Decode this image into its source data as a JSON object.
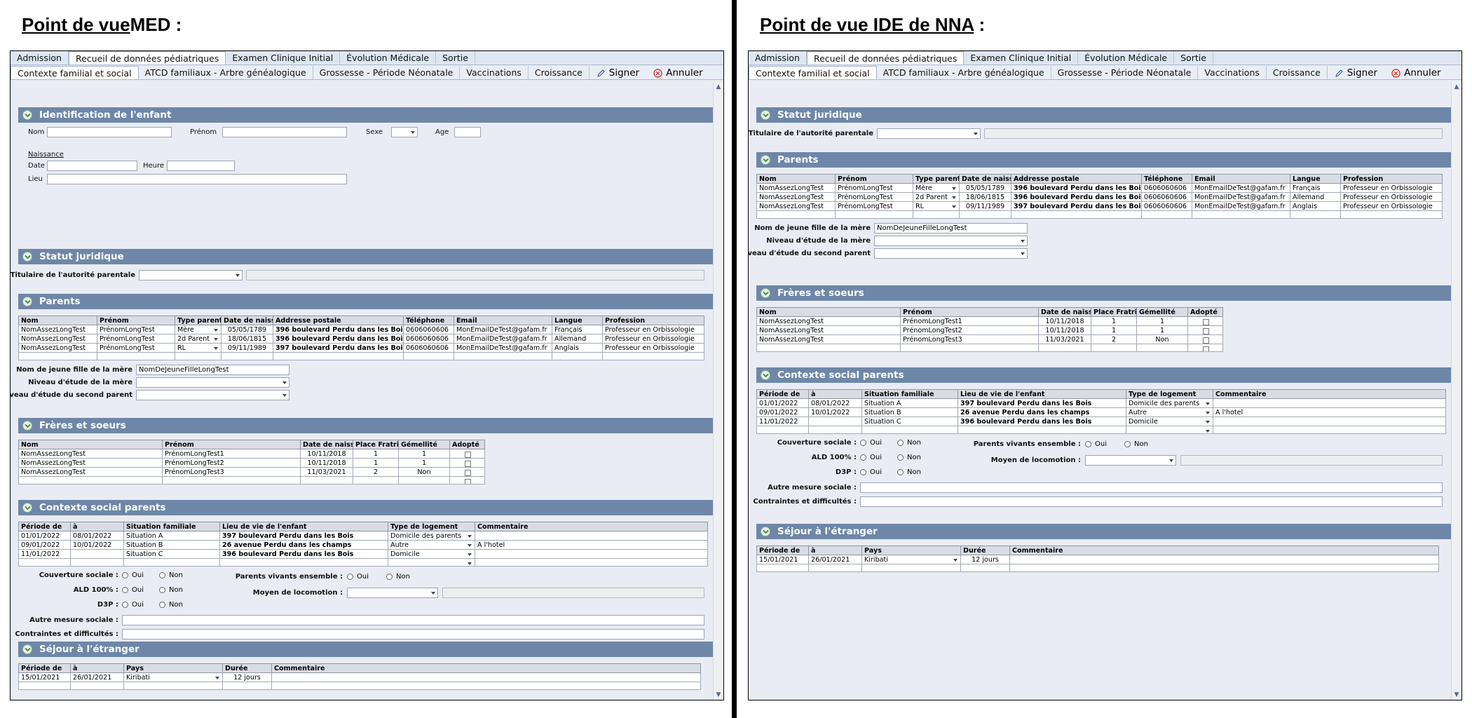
{
  "panels": {
    "med": {
      "title_underlined": "Point de vue",
      "title_rest": "MED",
      "title_colon": " :"
    },
    "nna": {
      "title_underlined": "Point de vue IDE de NNA",
      "title_rest": "",
      "title_colon": " :"
    }
  },
  "tabs_row1": [
    "Admission",
    "Recueil de données pédiatriques",
    "Examen Clinique Initial",
    "Évolution Médicale",
    "Sortie"
  ],
  "tabs_row2": [
    "Contexte familial et social",
    "ATCD familiaux - Arbre généalogique",
    "Grossesse - Période Néonatale",
    "Vaccinations",
    "Croissance"
  ],
  "actions": {
    "sign": "Signer",
    "cancel": "Annuler"
  },
  "sections": {
    "identification": "Identification de l'enfant",
    "statut": "Statut juridique",
    "parents": "Parents",
    "freres": "Frères et soeurs",
    "contexte": "Contexte social  parents",
    "sejour": "Séjour à l'étranger"
  },
  "identification": {
    "nom": "Nom",
    "prenom": "Prénom",
    "sexe": "Sexe",
    "age": "Age",
    "naissance": "Naissance",
    "date": "Date",
    "heure": "Heure",
    "lieu": "Lieu"
  },
  "statut": {
    "titulaire": "Titulaire de l'autorité parentale"
  },
  "parents": {
    "headers": [
      "Nom",
      "Prénom",
      "Type parent",
      "Date de naiss.",
      "Addresse postale",
      "Téléphone",
      "Email",
      "Langue",
      "Profession"
    ],
    "rows": [
      [
        "NomAssezLongTest",
        "PrénomLongTest",
        "Mère",
        "05/05/1789",
        "396 boulevard Perdu dans les Bois",
        "0606060606",
        "MonEmailDeTest@gafam.fr",
        "Français",
        "Professeur en Orbissologie"
      ],
      [
        "NomAssezLongTest",
        "PrénomLongTest",
        "2d Parent",
        "18/06/1815",
        "396 boulevard Perdu dans les Bois",
        "0606060606",
        "MonEmailDeTest@gafam.fr",
        "Allemand",
        "Professeur en Orbissologie"
      ],
      [
        "NomAssezLongTest",
        "PrénomLongTest",
        "RL",
        "09/11/1989",
        "397 boulevard Perdu dans les Bois",
        "0606060606",
        "MonEmailDeTest@gafam.fr",
        "Anglais",
        "Professeur en Orbissologie"
      ]
    ],
    "maiden_label": "Nom de jeune fille de la mère",
    "maiden_value": "NomDeJeuneFilleLongTest",
    "etude_mere": "Niveau d'étude de la mère",
    "etude_second": "Niveau d'étude du second parent"
  },
  "freres": {
    "headers": [
      "Nom",
      "Prénom",
      "Date de naiss.",
      "Place Fratrie",
      "Gémellité",
      "Adopté"
    ],
    "rows": [
      [
        "NomAssezLongTest",
        "PrénomLongTest1",
        "10/11/2018",
        "1",
        "1"
      ],
      [
        "NomAssezLongTest",
        "PrénomLongTest2",
        "10/11/2018",
        "1",
        "1"
      ],
      [
        "NomAssezLongTest",
        "PrénomLongTest3",
        "11/03/2021",
        "2",
        "Non"
      ]
    ]
  },
  "contexte": {
    "headers": [
      "Période  de",
      "à",
      "Situation familiale",
      "Lieu de vie de l'enfant",
      "Type de logement",
      "Commentaire"
    ],
    "rows": [
      [
        "01/01/2022",
        "08/01/2022",
        "Situation A",
        "397 boulevard Perdu dans les Bois",
        "Domicile des parents",
        ""
      ],
      [
        "09/01/2022",
        "10/01/2022",
        "Situation B",
        "26 avenue Perdu dans les champs",
        "Autre",
        "A l'hotel"
      ],
      [
        "11/01/2022",
        "",
        "Situation C",
        "396 boulevard Perdu dans les Bois",
        "Domicile",
        ""
      ]
    ],
    "couverture": "Couverture sociale :",
    "ald": "ALD 100% :",
    "d3p": "D3P :",
    "oui": "Oui",
    "non": "Non",
    "parents_vivants": "Parents vivants ensemble :",
    "locomotion": "Moyen de locomotion :",
    "autre_mesure": "Autre mesure sociale :",
    "contraintes": "Contraintes et difficultés :"
  },
  "sejour": {
    "headers": [
      "Période  de",
      "à",
      "Pays",
      "Durée",
      "Commentaire"
    ],
    "rows": [
      [
        "15/01/2021",
        "26/01/2021",
        "Kiribati",
        "12 jours",
        ""
      ]
    ]
  }
}
